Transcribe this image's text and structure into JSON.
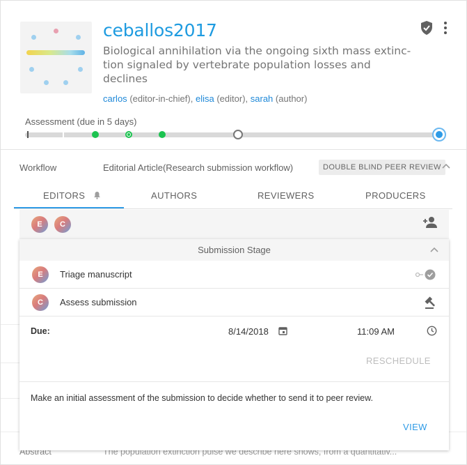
{
  "header": {
    "title": "ceballos2017",
    "subtitle": "Biological annihilation via the ongoing sixth mass extinc-tion signaled by vertebrate population losses and declines",
    "contributors": [
      {
        "name": "carlos",
        "role": "(editor-in-chief),"
      },
      {
        "name": "elisa",
        "role": "(editor),"
      },
      {
        "name": "sarah",
        "role": "(author)"
      }
    ]
  },
  "assessment": {
    "label": "Assessment (due in 5 days)"
  },
  "workflow": {
    "label": "Workflow",
    "name": "Editorial Article(Research submission workflow)",
    "badge": "DOUBLE BLIND PEER REVIEW"
  },
  "tabs": [
    {
      "label": "EDITORS",
      "active": true
    },
    {
      "label": "AUTHORS",
      "active": false
    },
    {
      "label": "REVIEWERS",
      "active": false
    },
    {
      "label": "PRODUCERS",
      "active": false
    }
  ],
  "editors": {
    "avatars": [
      "E",
      "C"
    ]
  },
  "stage": {
    "title": "Submission Stage",
    "tasks": [
      {
        "avatar": "E",
        "label": "Triage manuscript"
      },
      {
        "avatar": "C",
        "label": "Assess submission"
      }
    ],
    "due_label": "Due:",
    "due_date": "8/14/2018",
    "due_time": "11:09  AM",
    "reschedule": "RESCHEDULE",
    "description": "Make an initial assessment of the submission to decide whether to send it to peer review.",
    "view": "VIEW"
  },
  "background": {
    "abstract_label": "Abstract",
    "abstract_text": "The population extinction pulse we describe here shows, from a quantitativ..."
  },
  "colors": {
    "accent": "#2f9be6",
    "title": "#1e9be0",
    "done": "#1cc350"
  }
}
